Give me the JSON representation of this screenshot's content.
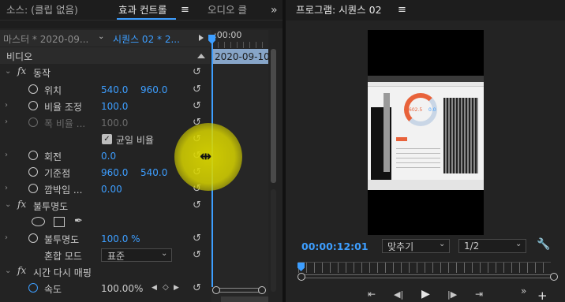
{
  "tabs": {
    "source": "소스: (클립 없음)",
    "effects": "효과 컨트롤",
    "audio": "오디오 클",
    "program": "프로그램: 시퀀스 02",
    "expand": "»",
    "menu": "≡"
  },
  "ec": {
    "master": "마스터 * 2020-09...",
    "sequence": "시퀀스 02 * 2...",
    "time_start": ":00:00",
    "clip_name": "2020-09-10",
    "video_header": "비디오",
    "motion": "동작",
    "position_label": "위치",
    "position_x": "540.0",
    "position_y": "960.0",
    "scale_label": "비율 조정",
    "scale_value": "100.0",
    "scale_width_label": "폭 비율 ...",
    "scale_width_value": "100.0",
    "uniform_scale": "균일 비율",
    "rotation_label": "회전",
    "rotation_value": "0.0",
    "anchor_label": "기준점",
    "anchor_x": "960.0",
    "anchor_y": "540.0",
    "flicker_label": "깜박임 ...",
    "flicker_value": "0.00",
    "opacity_header": "불투명도",
    "opacity_label": "불투명도",
    "opacity_value": "100.0 %",
    "blend_label": "혼합 모드",
    "blend_value": "표준",
    "time_remap_header": "시간 다시 매핑",
    "speed_label": "속도",
    "speed_value": "100.00%",
    "fx_label": "fx"
  },
  "program": {
    "timecode": "00:00:12:01",
    "fit": "맞추기",
    "resolution": "1/2",
    "preview_red_value": "602.5",
    "preview_blue_value": "0.0"
  },
  "colors": {
    "accent": "#3d9eff",
    "cursor_highlight": "#d8d400",
    "playhead": "#3d9eff",
    "clip": "#87a5c8"
  }
}
